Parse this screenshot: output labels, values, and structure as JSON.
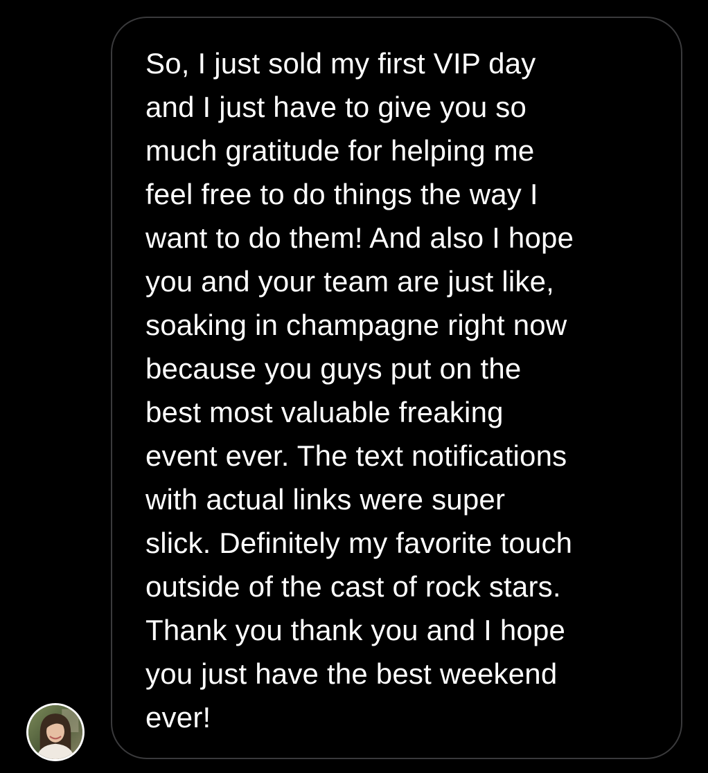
{
  "conversation": {
    "message": {
      "text": "So, I just sold my first VIP day\nand I just have to give you so\nmuch gratitude for helping me\nfeel free to do things the way I\nwant to do them! And also I hope\nyou and your team are just like,\nsoaking in champagne right now\nbecause you guys put on the\nbest most valuable freaking\nevent ever. The text notifications\nwith actual links were  super\nslick. Definitely my favorite touch\noutside of the cast of rock stars.\nThank you thank you and I hope\nyou just have the best weekend\never!"
    },
    "sender": {
      "avatar_icon": "profile-photo"
    }
  },
  "theme": {
    "background": "#000000",
    "bubble_border": "#3a3a3c",
    "text_color": "#ffffff",
    "avatar_ring": "#ffffff"
  }
}
